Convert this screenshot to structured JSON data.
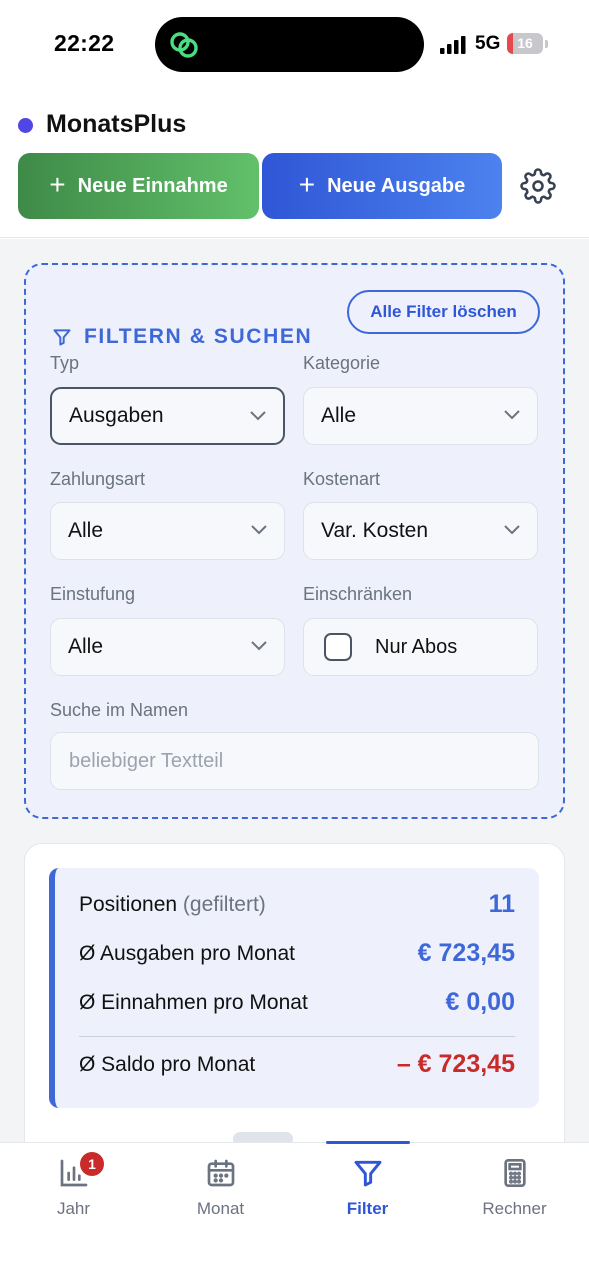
{
  "status_bar": {
    "time": "22:22",
    "network": "5G",
    "battery": "16",
    "battery_level": 0.16,
    "island_icon": "link-app-icon"
  },
  "header": {
    "app_name": "MonatsPlus",
    "brand_color": "#4f46e5",
    "income_button": "Neue Einnahme",
    "expense_button": "Neue Ausgabe",
    "settings_icon": "gear-icon"
  },
  "filter": {
    "title": "FILTERN & SUCHEN",
    "clear_button": "Alle Filter löschen",
    "typ": {
      "label": "Typ",
      "value": "Ausgaben"
    },
    "kategorie": {
      "label": "Kategorie",
      "value": "Alle"
    },
    "zahlungsart": {
      "label": "Zahlungsart",
      "value": "Alle"
    },
    "kostenart": {
      "label": "Kostenart",
      "value": "Var. Kosten"
    },
    "einstufung": {
      "label": "Einstufung",
      "value": "Alle"
    },
    "einschraenken": {
      "label": "Einschränken",
      "checkbox_label": "Nur Abos",
      "checked": false
    },
    "search": {
      "label": "Suche im Namen",
      "placeholder": "beliebiger Textteil",
      "value": ""
    }
  },
  "summary": {
    "positions_label": "Positionen",
    "positions_note": "(gefiltert)",
    "positions_value": "11",
    "expenses_label": "Ø Ausgaben pro Monat",
    "expenses_value": "€ 723,45",
    "income_label": "Ø Einnahmen pro Monat",
    "income_value": "€ 0,00",
    "balance_label": "Ø Saldo pro Monat",
    "balance_value": "– € 723,45",
    "accent_color": "#3e68d8",
    "negative_color": "#c92a2a"
  },
  "tabs": [
    {
      "label": "Jahr",
      "icon": "bar-chart-icon",
      "badge": "1",
      "active": false
    },
    {
      "label": "Monat",
      "icon": "calendar-icon",
      "active": false
    },
    {
      "label": "Filter",
      "icon": "filter-icon",
      "active": true
    },
    {
      "label": "Rechner",
      "icon": "calculator-icon",
      "active": false
    }
  ]
}
